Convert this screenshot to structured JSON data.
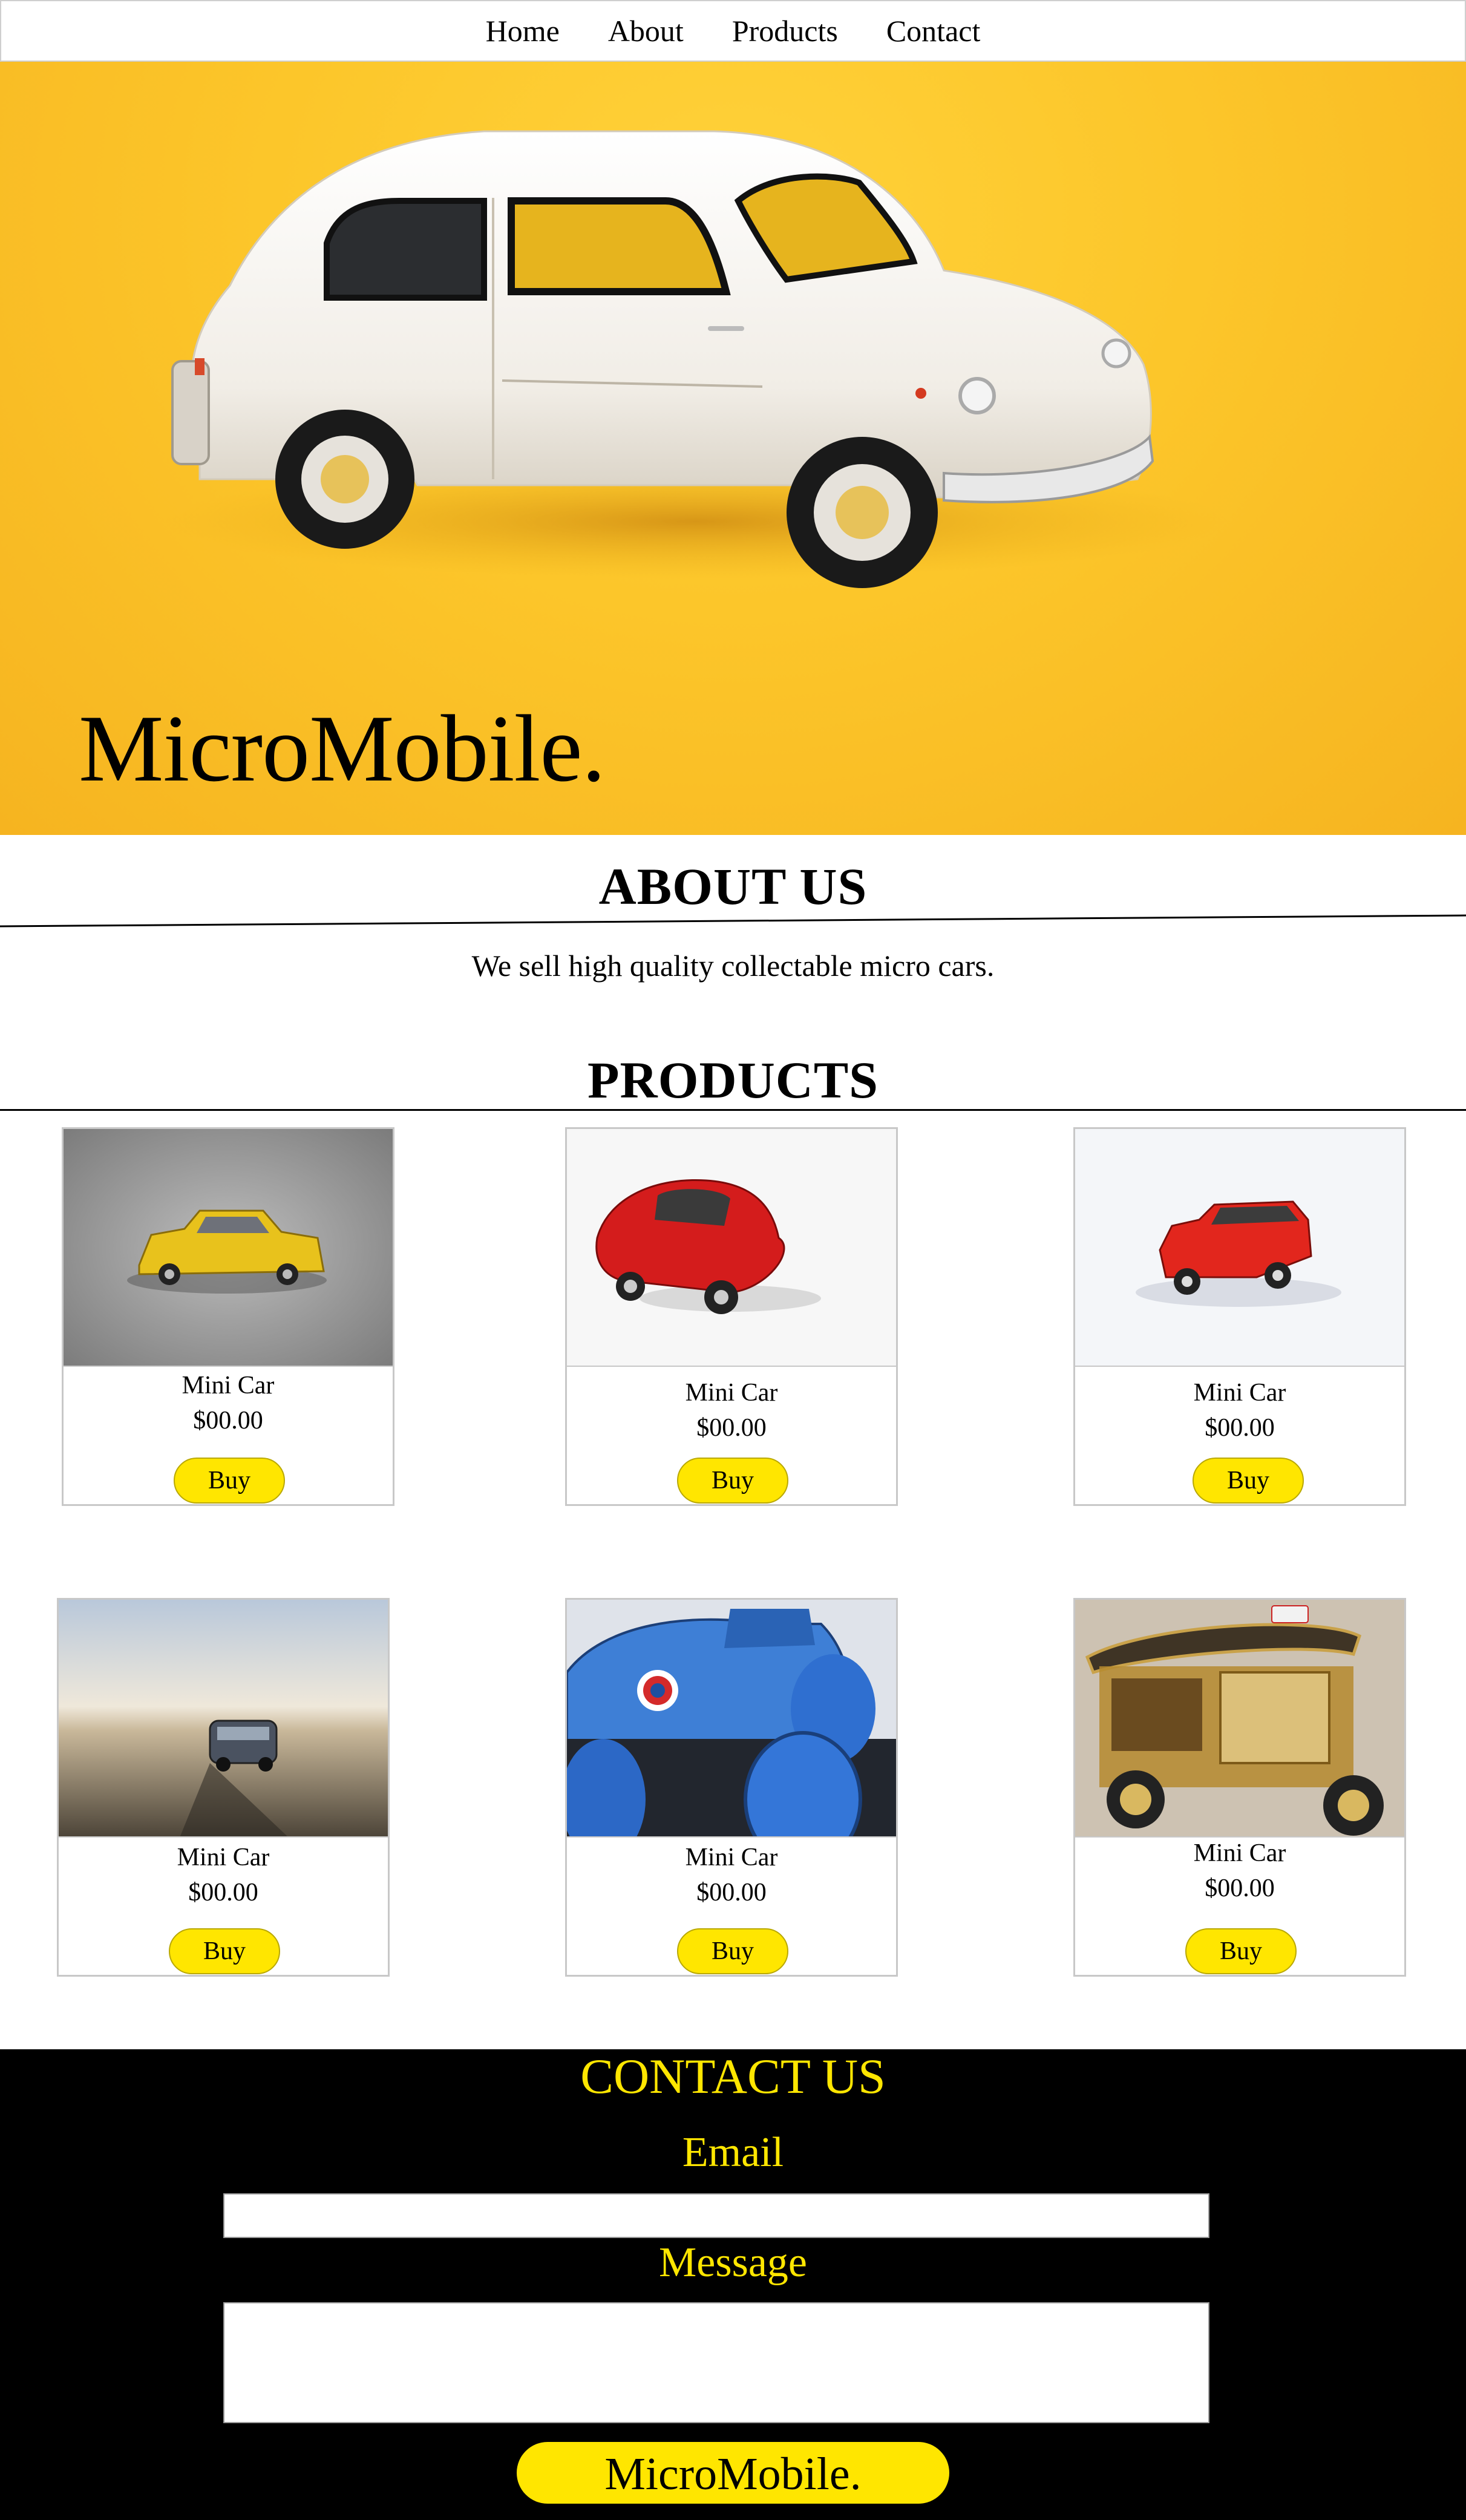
{
  "nav": {
    "items": [
      "Home",
      "About",
      "Products",
      "Contact"
    ]
  },
  "hero": {
    "brand": "MicroMobile."
  },
  "about": {
    "title": "ABOUT US",
    "text": "We sell high quality collectable micro cars."
  },
  "products": {
    "title": "PRODUCTS",
    "items": [
      {
        "name": "Mini Car",
        "price": "$00.00",
        "buy": "Buy"
      },
      {
        "name": "Mini Car",
        "price": "$00.00",
        "buy": "Buy"
      },
      {
        "name": "Mini Car",
        "price": "$00.00",
        "buy": "Buy"
      },
      {
        "name": "Mini Car",
        "price": "$00.00",
        "buy": "Buy"
      },
      {
        "name": "Mini Car",
        "price": "$00.00",
        "buy": "Buy"
      },
      {
        "name": "Mini Car",
        "price": "$00.00",
        "buy": "Buy"
      }
    ]
  },
  "contact": {
    "title": "CONTACT US",
    "email_label": "Email",
    "message_label": "Message",
    "email_value": "",
    "message_value": "",
    "submit_label": "MicroMobile."
  },
  "colors": {
    "accent": "#ffe600",
    "hero_bg": "#fcc62a",
    "footer_bg": "#000000"
  }
}
